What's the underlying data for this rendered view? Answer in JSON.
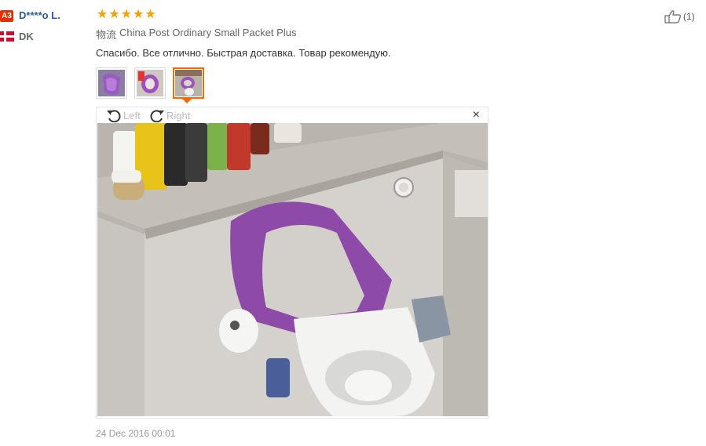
{
  "reviewer": {
    "badge": "A3",
    "name": "D****o L.",
    "country": "DK"
  },
  "rating": {
    "stars": 5
  },
  "shipping": {
    "label": "物流",
    "method": "China Post Ordinary Small Packet Plus"
  },
  "review_text": "Спасибо. Все отлично. Быстрая доставка. Товар рекомендую.",
  "viewer": {
    "rotate_left": "Left",
    "rotate_right": "Right",
    "close": "×"
  },
  "date": "24 Dec 2016 00:01",
  "helpful": {
    "count": "(1)"
  },
  "colors": {
    "accent": "#f60",
    "star": "#f7a100",
    "badge": "#e62e04",
    "username": "#2f5a9e"
  }
}
